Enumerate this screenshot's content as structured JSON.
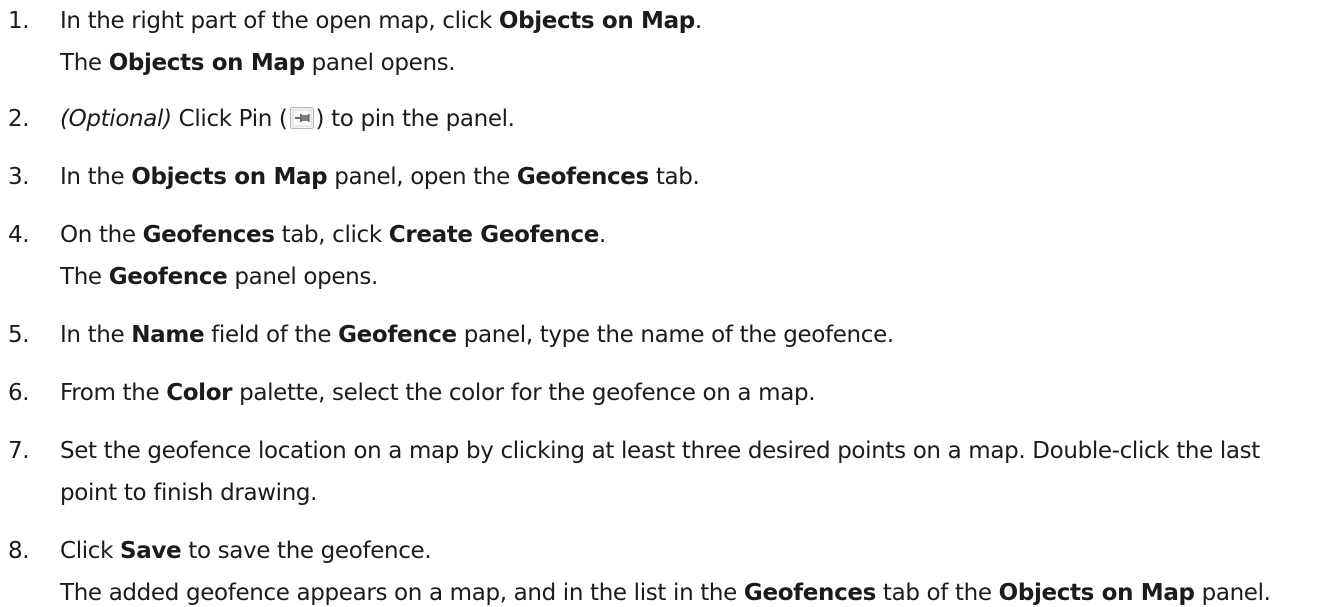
{
  "steps": [
    {
      "number": "1.",
      "lines": [
        [
          {
            "t": "In the right part of the open map, click "
          },
          {
            "t": "Objects on Map",
            "b": true
          },
          {
            "t": "."
          }
        ],
        [
          {
            "t": "The "
          },
          {
            "t": "Objects on Map",
            "b": true
          },
          {
            "t": " panel opens."
          }
        ]
      ]
    },
    {
      "number": "2.",
      "lines": [
        [
          {
            "t": "(Optional)",
            "i": true
          },
          {
            "t": " Click Pin ("
          },
          {
            "icon": "pin-icon"
          },
          {
            "t": ") to pin the panel."
          }
        ]
      ]
    },
    {
      "number": "3.",
      "lines": [
        [
          {
            "t": "In the "
          },
          {
            "t": "Objects on Map",
            "b": true
          },
          {
            "t": " panel, open the "
          },
          {
            "t": "Geofences",
            "b": true
          },
          {
            "t": " tab."
          }
        ]
      ]
    },
    {
      "number": "4.",
      "lines": [
        [
          {
            "t": "On the "
          },
          {
            "t": "Geofences",
            "b": true
          },
          {
            "t": " tab, click "
          },
          {
            "t": "Create Geofence",
            "b": true
          },
          {
            "t": "."
          }
        ],
        [
          {
            "t": "The "
          },
          {
            "t": "Geofence",
            "b": true
          },
          {
            "t": " panel opens."
          }
        ]
      ]
    },
    {
      "number": "5.",
      "lines": [
        [
          {
            "t": "In the "
          },
          {
            "t": "Name",
            "b": true
          },
          {
            "t": " field of the "
          },
          {
            "t": "Geofence",
            "b": true
          },
          {
            "t": " panel, type the name of the geofence."
          }
        ]
      ]
    },
    {
      "number": "6.",
      "lines": [
        [
          {
            "t": "From the "
          },
          {
            "t": "Color",
            "b": true
          },
          {
            "t": " palette, select the color for the geofence on a map."
          }
        ]
      ]
    },
    {
      "number": "7.",
      "lines": [
        [
          {
            "t": "Set the geofence location on a map by clicking at least three desired points on a map. Double-click the last"
          }
        ],
        [
          {
            "t": "point to finish drawing."
          }
        ]
      ]
    },
    {
      "number": "8.",
      "lines": [
        [
          {
            "t": "Click "
          },
          {
            "t": "Save",
            "b": true
          },
          {
            "t": " to save the geofence."
          }
        ],
        [
          {
            "t": "The added geofence appears on a map, and in the list in the "
          },
          {
            "t": "Geofences",
            "b": true
          },
          {
            "t": " tab of the "
          },
          {
            "t": "Objects on Map",
            "b": true
          },
          {
            "t": " panel."
          }
        ]
      ]
    }
  ]
}
